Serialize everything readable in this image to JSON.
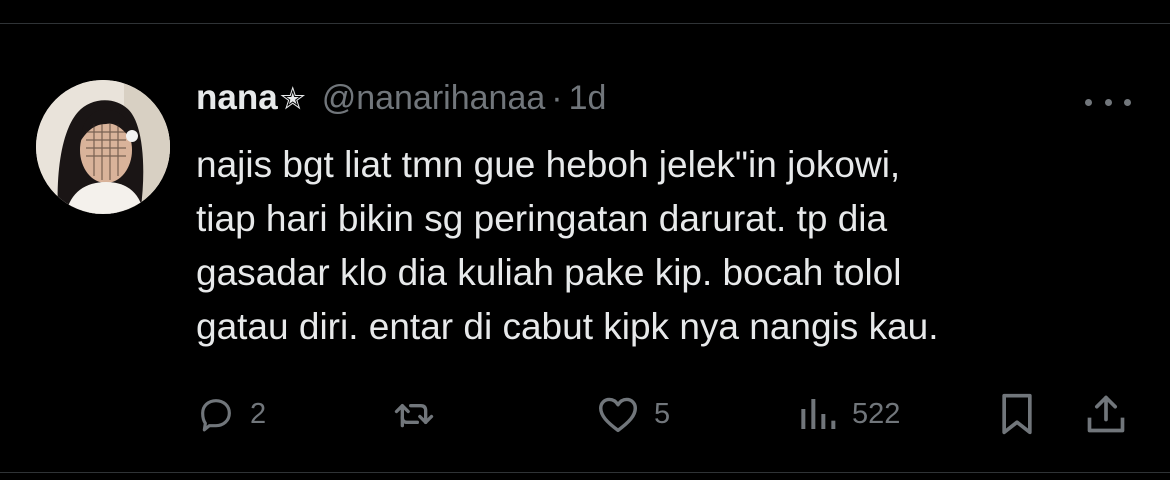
{
  "tweet": {
    "author": {
      "display_name": "nana",
      "badge": "✭",
      "handle": "@nanarihanaa",
      "separator": "·",
      "time": "1d"
    },
    "text_lines": [
      "najis bgt liat tmn gue heboh jelek\"in jokowi,",
      "tiap hari bikin sg peringatan darurat. tp dia",
      "gasadar klo dia kuliah pake kip. bocah tolol",
      "gatau diri. entar di cabut kipk nya nangis kau."
    ],
    "actions": {
      "replies": "2",
      "reposts": "",
      "likes": "5",
      "views": "522"
    }
  },
  "icons": {
    "star": "star-icon",
    "more": "more-icon",
    "reply": "reply-icon",
    "repost": "repost-icon",
    "like": "heart-icon",
    "views": "views-icon",
    "bookmark": "bookmark-icon",
    "share": "share-icon"
  },
  "colors": {
    "background": "#000000",
    "primary_text": "#e7e9ea",
    "secondary_text": "#71767b",
    "divider": "#2f3336"
  }
}
